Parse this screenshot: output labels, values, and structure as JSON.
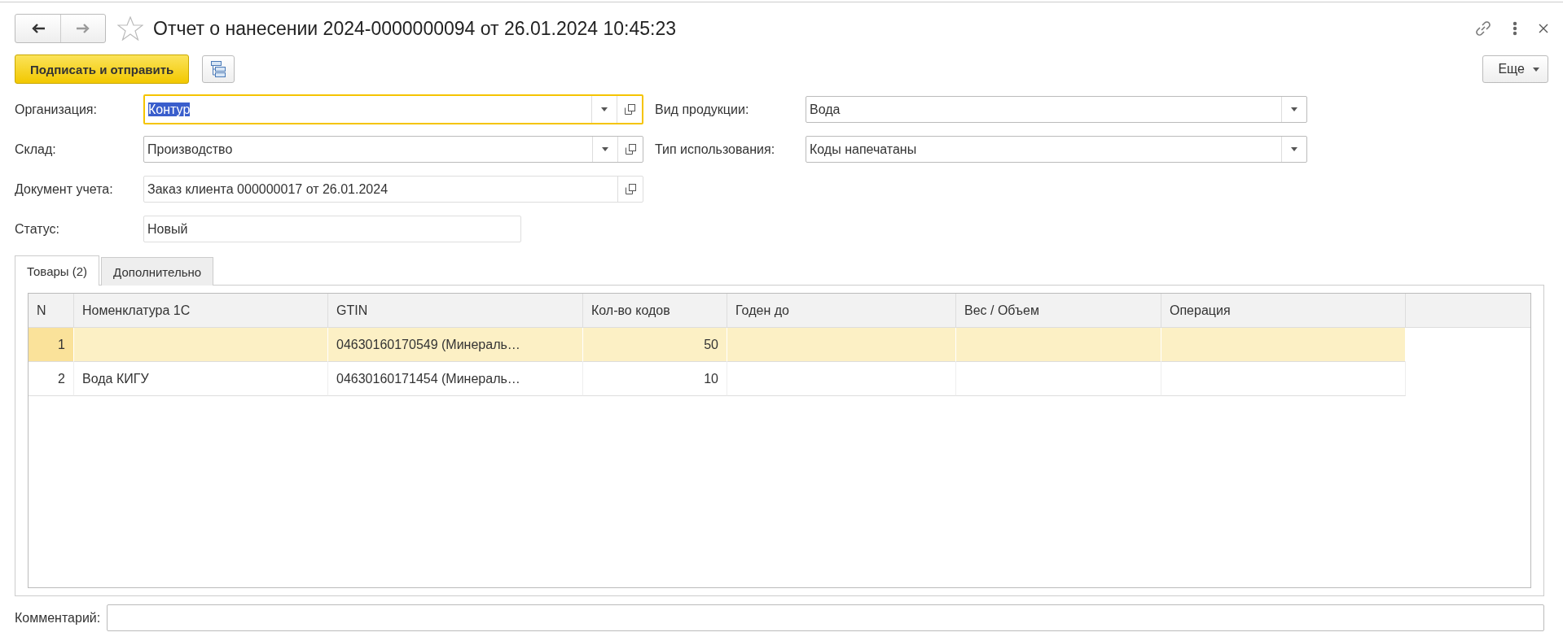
{
  "window": {
    "title": "Отчет о нанесении 2024-0000000094 от 26.01.2024 10:45:23"
  },
  "toolbar": {
    "primary_button": "Подписать и отправить",
    "more_button": "Еще"
  },
  "fields_left": [
    {
      "label": "Организация:",
      "value": "Контур",
      "kind": "combo",
      "focused": true
    },
    {
      "label": "Склад:",
      "value": "Производство",
      "kind": "combo",
      "focused": false
    },
    {
      "label": "Документ учета:",
      "value": "Заказ клиента 000000017 от 26.01.2024",
      "kind": "ref",
      "focused": false
    },
    {
      "label": "Статус:",
      "value": "Новый",
      "kind": "plain",
      "focused": false
    }
  ],
  "fields_right": [
    {
      "label": "Вид продукции:",
      "value": "Вода",
      "kind": "choice",
      "focused": false
    },
    {
      "label": "Тип использования:",
      "value": "Коды напечатаны",
      "kind": "choice",
      "focused": false
    }
  ],
  "tabs": [
    {
      "label": "Товары (2)",
      "selected": true
    },
    {
      "label": "Дополнительно",
      "selected": false
    }
  ],
  "table": {
    "columns": [
      {
        "title": "N"
      },
      {
        "title": "Номенклатура 1С"
      },
      {
        "title": "GTIN"
      },
      {
        "title": "Кол-во кодов"
      },
      {
        "title": "Годен до"
      },
      {
        "title": "Вес / Объем"
      },
      {
        "title": "Операция"
      }
    ],
    "rows": [
      {
        "selected": true,
        "cells": [
          "1",
          "",
          "04630160170549 (Минераль…",
          "50",
          "",
          "",
          ""
        ]
      },
      {
        "selected": false,
        "cells": [
          "2",
          "Вода КИГУ",
          "04630160171454 (Минераль…",
          "10",
          "",
          "",
          ""
        ]
      }
    ]
  },
  "comment": {
    "label": "Комментарий:"
  }
}
